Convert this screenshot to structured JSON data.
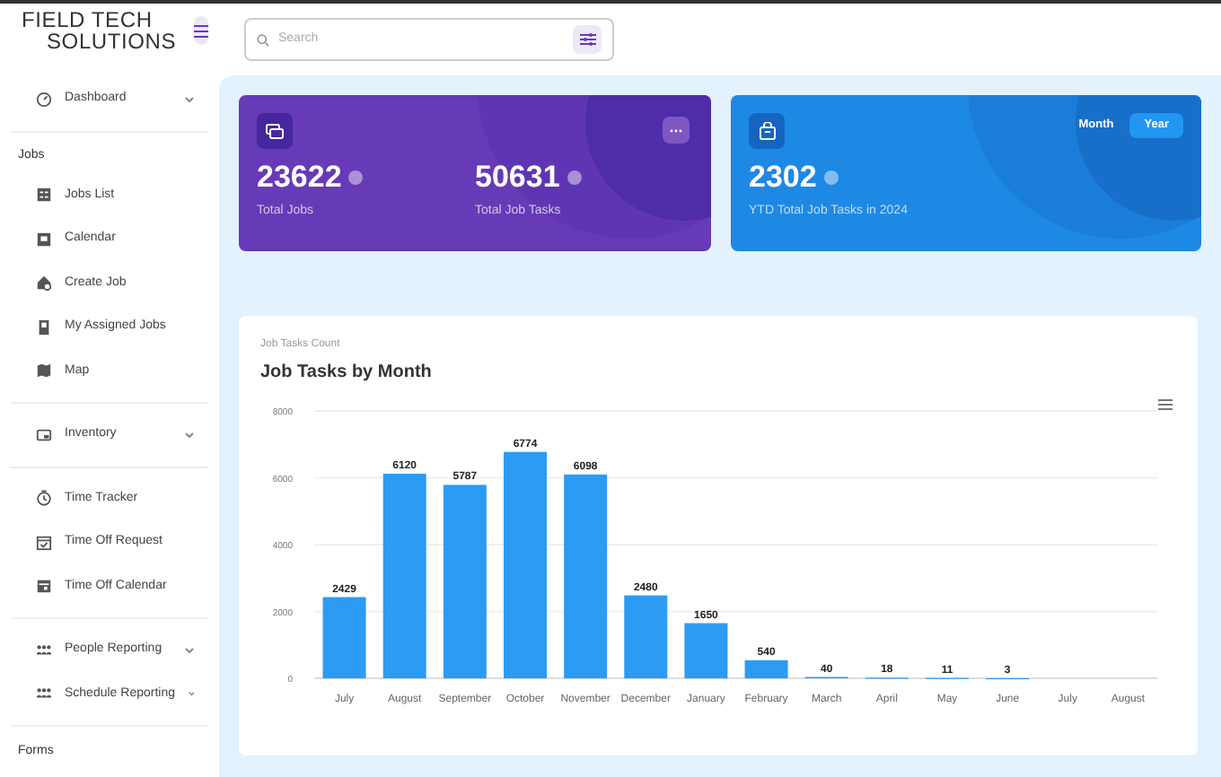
{
  "logo": {
    "line_1": "FIELD TECH",
    "line_2": "SOLUTIONS"
  },
  "search": {
    "placeholder": "Search"
  },
  "sidebar": {
    "sections": [
      {
        "items": [
          {
            "label": "Dashboard",
            "expandable": true
          }
        ]
      },
      {
        "heading": "Jobs",
        "items": [
          {
            "label": "Jobs List",
            "expandable": false
          },
          {
            "label": "Calendar",
            "expandable": false
          },
          {
            "label": "Create Job",
            "expandable": false
          },
          {
            "label": "My Assigned Jobs",
            "expandable": false
          },
          {
            "label": "Map",
            "expandable": false
          }
        ]
      },
      {
        "items": [
          {
            "label": "Inventory",
            "expandable": true
          }
        ]
      },
      {
        "items": [
          {
            "label": "Time Tracker",
            "expandable": false
          },
          {
            "label": "Time Off Request",
            "expandable": false
          },
          {
            "label": "Time Off Calendar",
            "expandable": false
          }
        ]
      },
      {
        "items": [
          {
            "label": "People Reporting",
            "expandable": true
          },
          {
            "label": "Schedule Reporting",
            "expandable": true
          }
        ]
      },
      {
        "heading": "Forms"
      }
    ]
  },
  "jobs_card": {
    "stats": [
      {
        "value": "23622",
        "label": "Total Jobs"
      },
      {
        "value": "50631",
        "label": "Total Job Tasks"
      }
    ]
  },
  "tasks_card": {
    "toggle": [
      {
        "label": "Month",
        "selected": false
      },
      {
        "label": "Year",
        "selected": true
      }
    ],
    "stats": [
      {
        "value": "2302",
        "label": "YTD Total Job Tasks in 2024"
      }
    ]
  },
  "chart_card": {
    "subtitle": "Job Tasks Count",
    "title": "Job Tasks by Month",
    "chart_data": {
      "type": "bar",
      "categories": [
        "July",
        "August",
        "September",
        "October",
        "November",
        "December",
        "January",
        "February",
        "March",
        "April",
        "May",
        "June",
        "July",
        "August"
      ],
      "series": [
        {
          "color": "#2b9bf4",
          "values": [
            2429,
            6120,
            5787,
            6774,
            6098,
            2480,
            1650,
            540,
            40,
            18,
            11,
            3,
            null,
            null
          ]
        }
      ],
      "ylim": [
        0,
        8000
      ],
      "grid": true,
      "yticks": [
        0,
        2000,
        4000,
        6000,
        8000
      ],
      "data_labels": true
    }
  }
}
